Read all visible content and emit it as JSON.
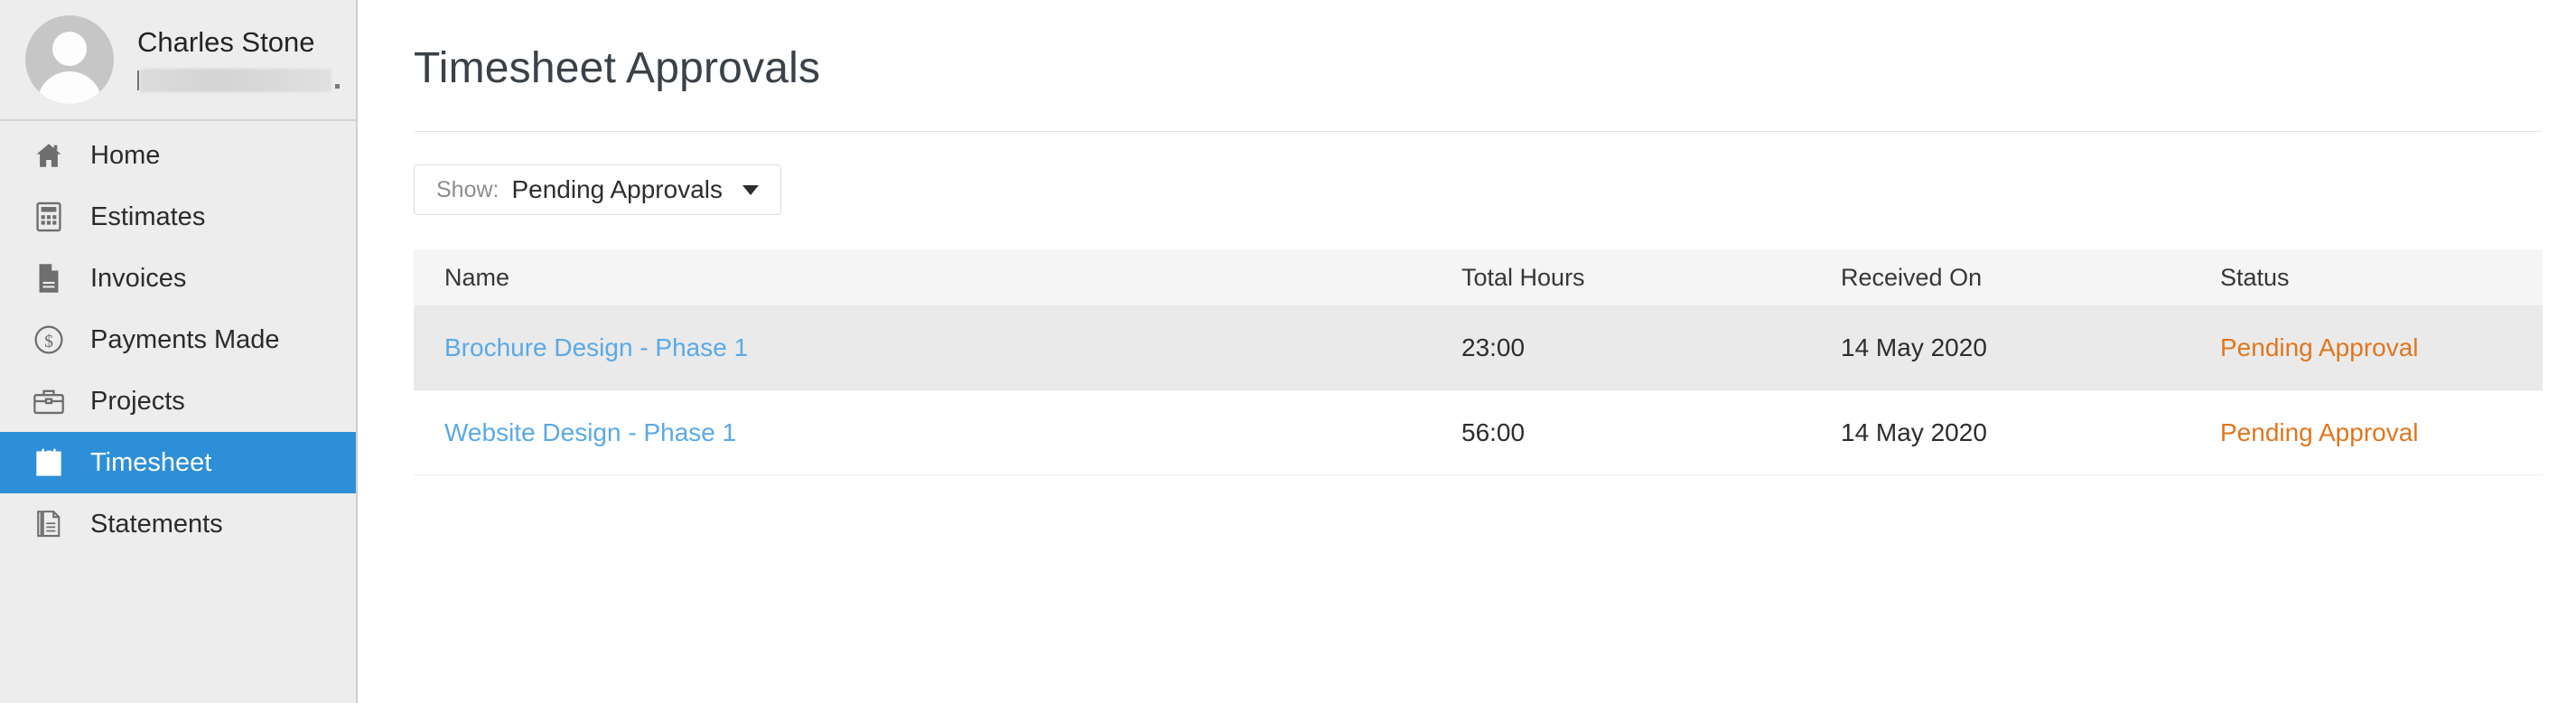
{
  "sidebar": {
    "user": {
      "name": "Charles Stone",
      "email_redacted": true
    },
    "items": [
      {
        "label": "Home",
        "icon": "home-icon",
        "active": false
      },
      {
        "label": "Estimates",
        "icon": "calculator-icon",
        "active": false
      },
      {
        "label": "Invoices",
        "icon": "document-icon",
        "active": false
      },
      {
        "label": "Payments Made",
        "icon": "dollar-circle-icon",
        "active": false
      },
      {
        "label": "Projects",
        "icon": "briefcase-icon",
        "active": false
      },
      {
        "label": "Timesheet",
        "icon": "timesheet-icon",
        "active": true
      },
      {
        "label": "Statements",
        "icon": "documents-stack-icon",
        "active": false
      }
    ]
  },
  "main": {
    "title": "Timesheet Approvals",
    "filter": {
      "label": "Show:",
      "value": "Pending Approvals",
      "caret_icon": "chevron-down-icon"
    },
    "table": {
      "columns": [
        "Name",
        "Total Hours",
        "Received On",
        "Status"
      ],
      "rows": [
        {
          "name": "Brochure Design - Phase 1",
          "total_hours": "23:00",
          "received_on": "14 May 2020",
          "status": "Pending Approval",
          "hovered": true
        },
        {
          "name": "Website Design - Phase 1",
          "total_hours": "56:00",
          "received_on": "14 May 2020",
          "status": "Pending Approval",
          "hovered": false
        }
      ]
    }
  },
  "colors": {
    "sidebar_bg": "#ededed",
    "active_nav": "#2e8fd9",
    "link": "#5aa9e6",
    "status_pending": "#e0761f",
    "row_hover": "#eaeaea",
    "table_head_bg": "#f5f5f5"
  }
}
